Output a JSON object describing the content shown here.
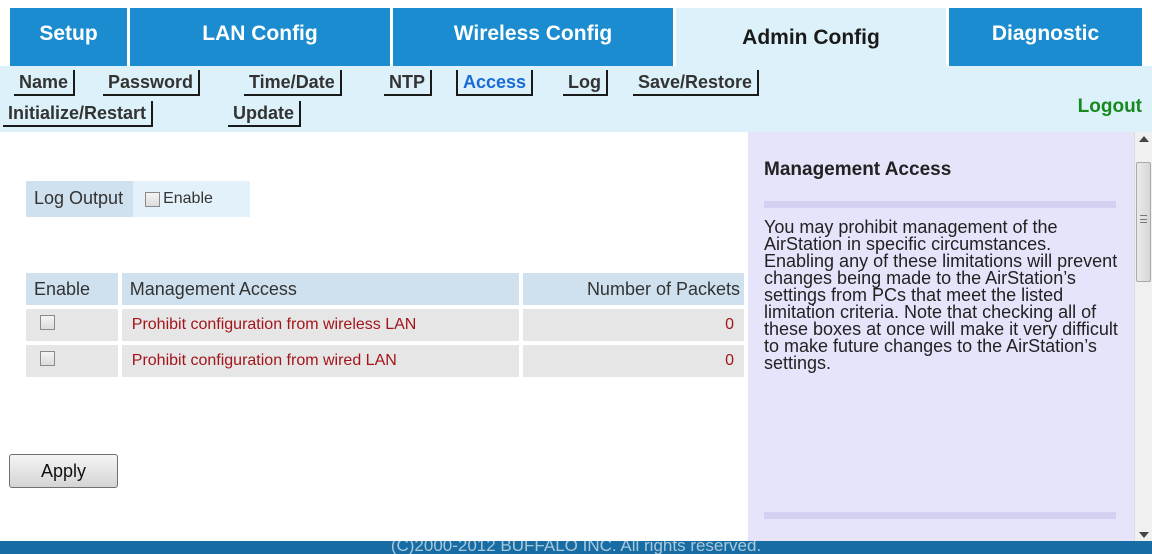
{
  "top_tabs": [
    {
      "label": "Setup"
    },
    {
      "label": "LAN Config"
    },
    {
      "label": "Wireless Config"
    },
    {
      "label": "Admin Config"
    },
    {
      "label": "Diagnostic"
    }
  ],
  "active_top_tab": "Admin Config",
  "sub_tabs": [
    {
      "label": "Name"
    },
    {
      "label": "Password"
    },
    {
      "label": "Time/Date"
    },
    {
      "label": "NTP"
    },
    {
      "label": "Access"
    },
    {
      "label": "Log"
    },
    {
      "label": "Save/Restore"
    },
    {
      "label": "Initialize/Restart"
    },
    {
      "label": "Update"
    }
  ],
  "active_sub_tab": "Access",
  "logout_label": "Logout",
  "log_output": {
    "label": "Log Output",
    "enable_label": "Enable",
    "enabled": false
  },
  "table": {
    "headers": {
      "enable": "Enable",
      "management_access": "Management Access",
      "packets": "Number of Packets"
    },
    "rows": [
      {
        "checked": false,
        "description": "Prohibit configuration from wireless LAN",
        "packets": "0"
      },
      {
        "checked": false,
        "description": "Prohibit configuration from wired LAN",
        "packets": "0"
      }
    ]
  },
  "apply_label": "Apply",
  "help": {
    "title": "Management Access",
    "text": "You may prohibit management of the AirStation in specific circumstances. Enabling any of these limitations will prevent changes being made to the AirStation’s settings from PCs that meet the listed limitation criteria. Note that checking all of these boxes at once will make it very difficult to make future changes to the AirStation’s settings."
  },
  "footer_text": "(C)2000-2012 BUFFALO INC. All rights reserved.",
  "colors": {
    "tab_blue": "#1a8ccf",
    "tab_active_bg": "#ddf1fa",
    "active_subtab_text": "#1a6bd6",
    "logout_green": "#168a1e",
    "row_text_red": "#a3151b",
    "help_bg": "#e6e4fb",
    "footer_bg": "#176da3"
  }
}
